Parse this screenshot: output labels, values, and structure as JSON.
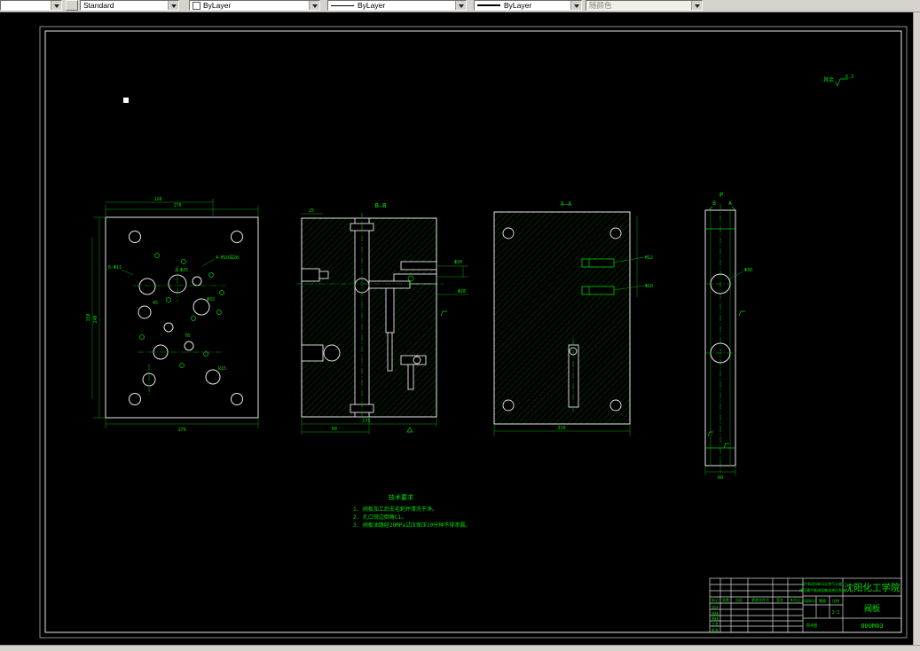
{
  "toolbar": {
    "layer_value": "",
    "style_value": "Standard",
    "color_value": "ByLayer",
    "linetype_value": "ByLayer",
    "lineweight_value": "ByLayer",
    "plotstyle_value": "随颜色"
  },
  "drawing": {
    "views": {
      "bb_label": "B—B",
      "aa_label": "A—A",
      "p_label": "P",
      "p_dir_b": "B",
      "p_dir_a": "A"
    },
    "roughness": {
      "prefix": "其余",
      "value": "6.3"
    },
    "dims": {
      "plan_w": "170",
      "plan_w2": "120",
      "plan_h": "240",
      "plan_h2": "158",
      "plan_b": "170",
      "plan_n1": "4-M10深20",
      "plan_n2": "6-Φ11",
      "plan_n3": "2-Φ25",
      "plan_n4": "Φ32",
      "plan_n5": "R15",
      "plan_n6": "45",
      "plan_n7": "78",
      "bb_top": "25",
      "bb_r1": "Φ20",
      "bb_r2": "Φ28",
      "bb_b1": "175",
      "bb_b2": "60",
      "aa_r1": "M12",
      "aa_r2": "Φ10",
      "aa_b": "310",
      "p_b": "60",
      "p_r": "Φ30"
    },
    "notes": {
      "title": "技术要求",
      "items": [
        "1. 阀板加工后去毛刺并清洗干净。",
        "2. 孔口锐边倒角C1。",
        "3. 阀板油路经20MPa试压保压10分钟不得渗漏。"
      ]
    },
    "title_block": {
      "project_line1": "QY40X500X3天然气计量",
      "project_line2": "调压撬平衡阀组集成液压系统",
      "school": "沈阳化工学院",
      "part_name": "阀板",
      "drawing_no": "000M03",
      "stage_label": "阶段标记",
      "weight_label": "重量",
      "scale_label": "比例",
      "scale_value": "1:2",
      "sheets": "共4张",
      "header_labels": [
        "标记",
        "处数",
        "分区",
        "更改文件号",
        "签名",
        "年月日"
      ],
      "signer_labels": [
        "设计",
        "校核",
        "审核",
        "工艺",
        "批准"
      ]
    }
  }
}
